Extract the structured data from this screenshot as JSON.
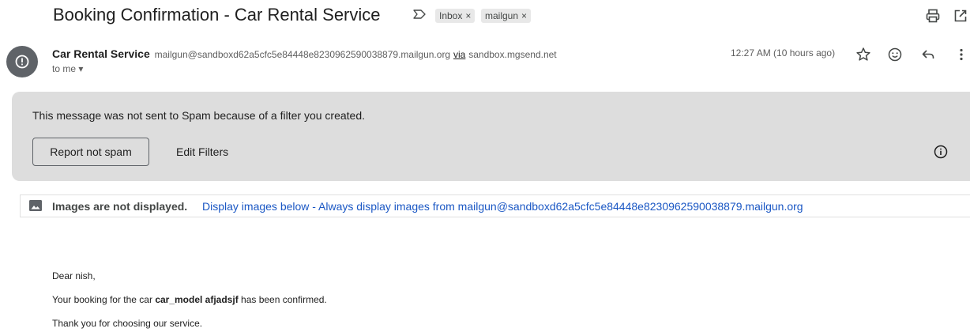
{
  "email": {
    "subject": "Booking Confirmation - Car Rental Service",
    "labels": [
      {
        "name": "Inbox",
        "remove": "×"
      },
      {
        "name": "mailgun",
        "remove": "×"
      }
    ],
    "sender": {
      "name": "Car Rental Service",
      "email": "mailgun@sandboxd62a5cfc5e84448e8230962590038879.mailgun.org",
      "via_label": "via",
      "via_domain": "sandbox.mgsend.net",
      "recipient": "to me ▾",
      "avatar_glyph": "!"
    },
    "timestamp": "12:27 AM (10 hours ago)"
  },
  "spam_notice": {
    "message": "This message was not sent to Spam because of a filter you created.",
    "report_button": "Report not spam",
    "edit_button": "Edit Filters"
  },
  "images_notice": {
    "bold": "Images are not displayed.",
    "link": "Display images below - Always display images from mailgun@sandboxd62a5cfc5e84448e8230962590038879.mailgun.org"
  },
  "body": {
    "greeting": "Dear nish,",
    "line1_prefix": "Your booking for the car ",
    "line1_bold": "car_model afjadsjf",
    "line1_suffix": " has been confirmed.",
    "line2": "Thank you for choosing our service."
  },
  "icons": {
    "important_marker": "important-marker-icon",
    "print": "print-icon",
    "open_new_window": "open-in-new-window-icon",
    "star": "star-icon",
    "emoji": "emoji-icon",
    "reply": "reply-icon",
    "more": "more-vert-icon",
    "info": "info-icon",
    "image": "image-icon"
  },
  "colors": {
    "spam_bg": "#dddddd",
    "link": "#1a57c4",
    "avatar": "#5f6368"
  }
}
